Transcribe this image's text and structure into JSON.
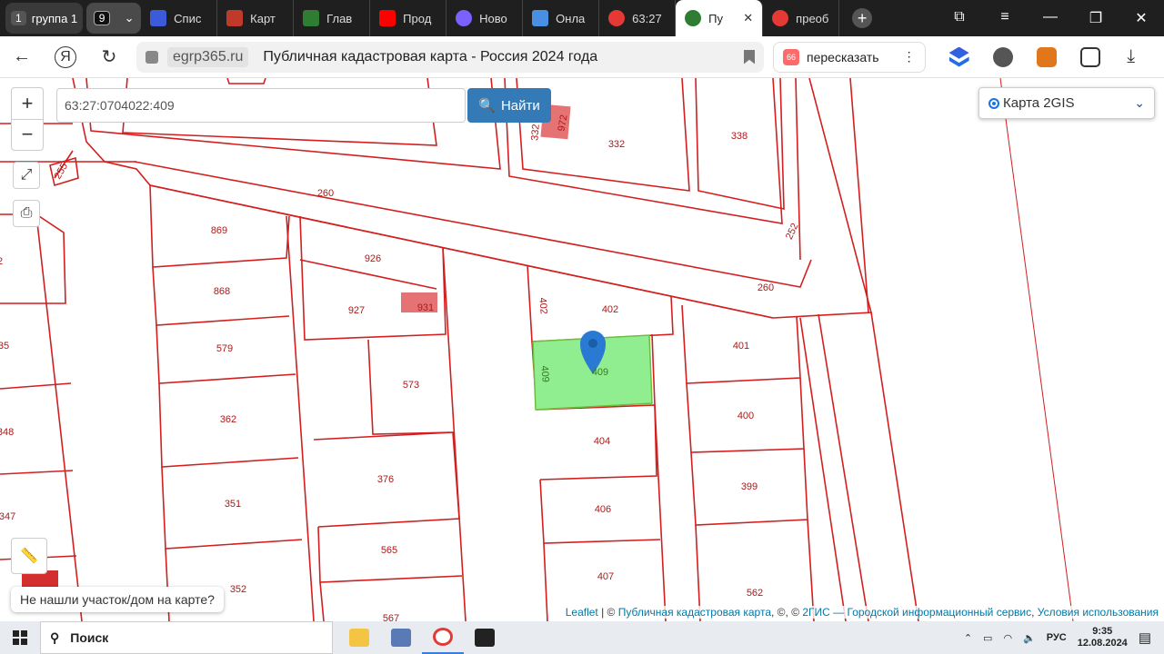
{
  "tabs": {
    "group_num": "1",
    "group_label": "группа 1",
    "count": "9",
    "items": [
      {
        "label": "Спис",
        "color": "#3b5bdb"
      },
      {
        "label": "Карт",
        "color": "#c0392b"
      },
      {
        "label": "Глав",
        "color": "#2e7d32"
      },
      {
        "label": "Прод",
        "color": "#ff0000"
      },
      {
        "label": "Ново",
        "color": "#7b61ff"
      },
      {
        "label": "Онла",
        "color": "#4a90e2"
      },
      {
        "label": "63:27",
        "color": "#e53935"
      },
      {
        "label": "Пу",
        "color": "#2e7d32"
      },
      {
        "label": "преоб",
        "color": "#e53935"
      }
    ],
    "close": "✕",
    "new_tab": "+"
  },
  "window": {
    "restore": "⧉",
    "menu": "≡",
    "minimize": "—",
    "maximize": "❐",
    "close": "✕"
  },
  "address": {
    "back": "←",
    "yandex": "Я",
    "reload": "↻",
    "domain": "egrp365.ru",
    "title": "Публичная кадастровая карта - Россия 2024 года",
    "retell_badge": "66",
    "retell": "пересказать",
    "more": "⋮",
    "download": "⤓"
  },
  "map": {
    "zoom_in": "+",
    "zoom_out": "−",
    "fullscreen": "⤢",
    "print": "⎙",
    "ruler": "📏",
    "search_value": "63:27:0704022:409",
    "search_button": "Найти",
    "layer": "Карта 2GIS",
    "layer_chevron": "⌄",
    "not_found": "Не нашли участок/дом на карте?",
    "attrib": {
      "leaflet": "Leaflet",
      "sep1": " | © ",
      "pkk": "Публичная кадастровая карта",
      "sep2": ", ©, © ",
      "gis": "2ГИС — Городской информационный сервис",
      "sep3": ", ",
      "terms": "Условия использования"
    },
    "labels": [
      "255",
      "260",
      "869",
      "926",
      "332",
      "332",
      "338",
      "972",
      "252",
      "868",
      "927",
      "931",
      "402",
      "402",
      "260",
      "579",
      "401",
      "409",
      "409",
      "573",
      "362",
      "400",
      "404",
      "376",
      "351",
      "399",
      "406",
      "565",
      "407",
      "352",
      "562",
      "347",
      "348",
      "35",
      "567",
      "2"
    ],
    "colors": {
      "line": "#d21f1f",
      "highlight": "#90ee90",
      "pink": "#e57373",
      "marker": "#2a7ad4"
    }
  },
  "taskbar": {
    "search": "Поиск",
    "lang": "РУС",
    "time": "9:35",
    "date": "12.08.2024"
  }
}
